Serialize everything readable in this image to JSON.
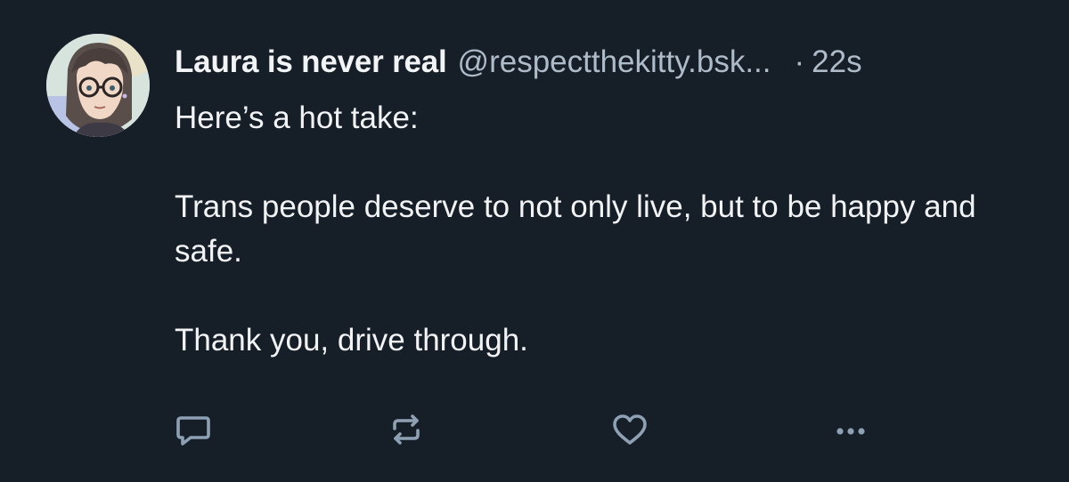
{
  "post": {
    "author": {
      "display_name": "Laura is never real",
      "handle": "@respectthekitty.bsk...",
      "avatar_icon": "avatar-image"
    },
    "separator": "·",
    "timestamp": "22s",
    "text": {
      "line1": "Here’s a hot take:",
      "line2": "Trans people deserve to not only live, but to be happy and safe.",
      "line3": "Thank you, drive through."
    },
    "actions": {
      "reply_icon": "speech-bubble-icon",
      "repost_icon": "repost-arrows-icon",
      "like_icon": "heart-icon",
      "more_icon": "ellipsis-icon"
    }
  },
  "colors": {
    "background": "#161e27",
    "text_primary": "#f1f3f5",
    "text_secondary": "#aebbc9",
    "icon": "#8ea0b3"
  }
}
